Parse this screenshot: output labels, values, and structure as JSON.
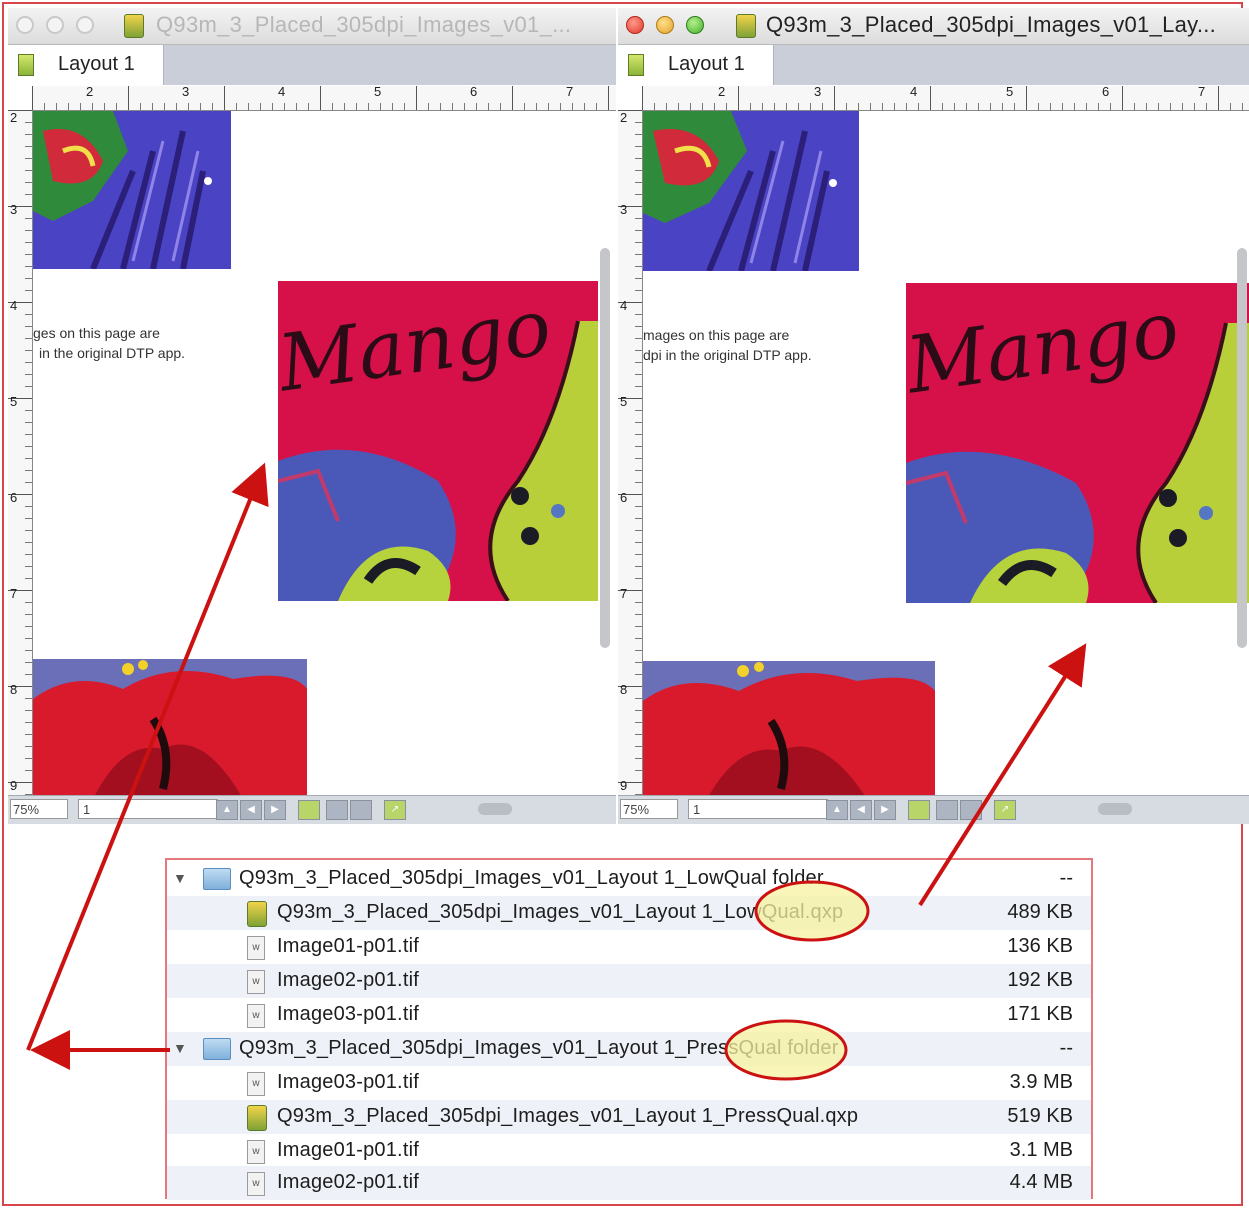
{
  "left_window": {
    "title": "Q93m_3_Placed_305dpi_Images_v01_...",
    "tab": "Layout 1",
    "zoom": "75%",
    "page": "1",
    "page_text_line1": "ges on this page are",
    "page_text_line2": "in the original DTP app.",
    "hruler_labels": [
      "2",
      "3",
      "4",
      "5",
      "6",
      "7"
    ],
    "vruler_labels": [
      "2",
      "3",
      "4",
      "5",
      "6",
      "7",
      "8",
      "9"
    ]
  },
  "right_window": {
    "title": "Q93m_3_Placed_305dpi_Images_v01_Lay...",
    "tab": "Layout 1",
    "zoom": "75%",
    "page": "1",
    "page_text_line1": "mages on this page are",
    "page_text_line2": "dpi in the original DTP app.",
    "hruler_labels": [
      "2",
      "3",
      "4",
      "5",
      "6",
      "7"
    ],
    "vruler_labels": [
      "2",
      "3",
      "4",
      "5",
      "6",
      "7",
      "8",
      "9"
    ]
  },
  "artwork_text": "Mango",
  "finder": {
    "rows": [
      {
        "type": "folder",
        "name": "Q93m_3_Placed_305dpi_Images_v01_Layout 1_LowQual folder",
        "size": "--"
      },
      {
        "type": "qxp",
        "name": "Q93m_3_Placed_305dpi_Images_v01_Layout 1_LowQual.qxp",
        "size": "489 KB"
      },
      {
        "type": "tif",
        "name": "Image01-p01.tif",
        "size": "136 KB"
      },
      {
        "type": "tif",
        "name": "Image02-p01.tif",
        "size": "192 KB"
      },
      {
        "type": "tif",
        "name": "Image03-p01.tif",
        "size": "171 KB"
      },
      {
        "type": "folder",
        "name": "Q93m_3_Placed_305dpi_Images_v01_Layout 1_PressQual folder",
        "size": "--"
      },
      {
        "type": "tif",
        "name": "Image03-p01.tif",
        "size": "3.9 MB"
      },
      {
        "type": "qxp",
        "name": "Q93m_3_Placed_305dpi_Images_v01_Layout 1_PressQual.qxp",
        "size": "519 KB"
      },
      {
        "type": "tif",
        "name": "Image01-p01.tif",
        "size": "3.1 MB"
      },
      {
        "type": "tif",
        "name": "Image02-p01.tif",
        "size": "4.4 MB"
      }
    ]
  },
  "colors": {
    "annotation_red": "#cc1111",
    "highlight_fill": "#f7f2a0",
    "artwork_bg": "#d6114a",
    "finder_border": "#e4787c"
  },
  "icons": {
    "folder": "folder-icon",
    "qxp": "quark-document-icon",
    "tif": "tif-file-icon"
  }
}
